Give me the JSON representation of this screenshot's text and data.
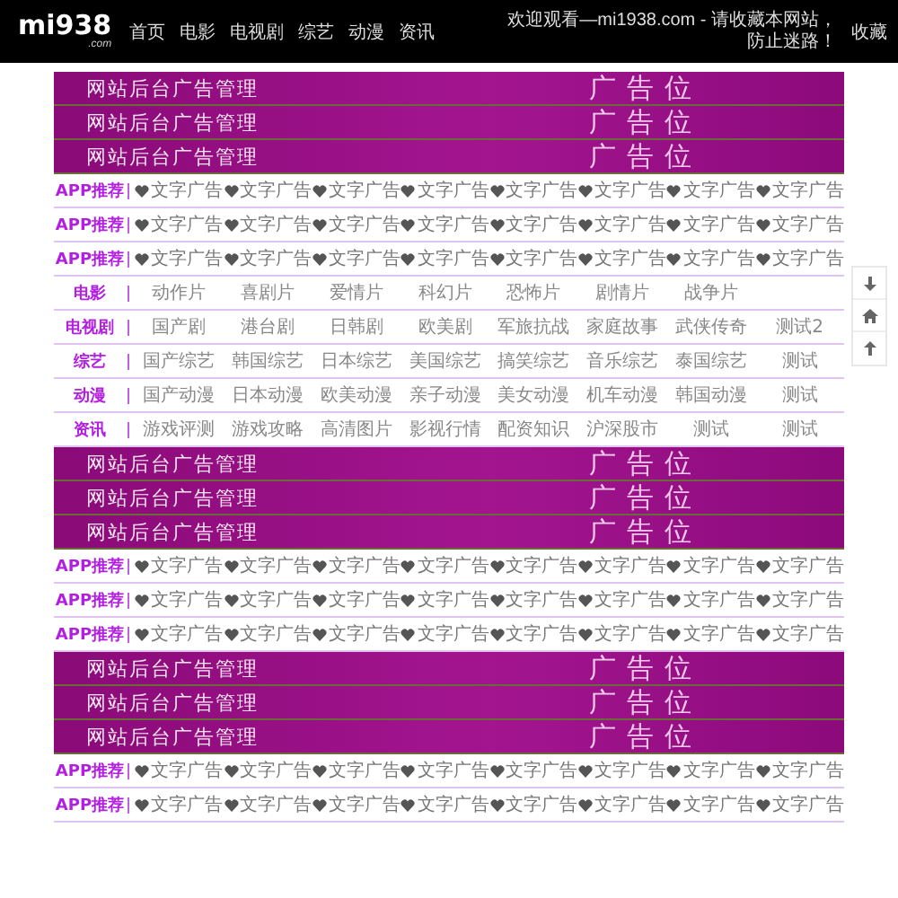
{
  "header": {
    "logo": "mi938",
    "logo_sub": ".com",
    "nav": [
      "首页",
      "电影",
      "电视剧",
      "综艺",
      "动漫",
      "资讯"
    ],
    "welcome": "欢迎观看—mi1938.com - 请收藏本网站，防止迷路！",
    "bookmark": "收藏"
  },
  "side_tools": [
    {
      "kind": "down"
    },
    {
      "kind": "home"
    },
    {
      "kind": "up"
    }
  ],
  "blocks": [
    {
      "kind": "banner",
      "title": "网站后台广告管理",
      "slot": "广告位"
    },
    {
      "kind": "banner",
      "title": "网站后台广告管理",
      "slot": "广告位"
    },
    {
      "kind": "banner",
      "title": "网站后台广告管理",
      "slot": "广告位"
    },
    {
      "kind": "app",
      "label": "APP推荐",
      "items": [
        "文字广告",
        "文字广告",
        "文字广告",
        "文字广告",
        "文字广告",
        "文字广告",
        "文字广告",
        "文字广告"
      ]
    },
    {
      "kind": "app",
      "label": "APP推荐",
      "items": [
        "文字广告",
        "文字广告",
        "文字广告",
        "文字广告",
        "文字广告",
        "文字广告",
        "文字广告",
        "文字广告"
      ]
    },
    {
      "kind": "app",
      "label": "APP推荐",
      "items": [
        "文字广告",
        "文字广告",
        "文字广告",
        "文字广告",
        "文字广告",
        "文字广告",
        "文字广告",
        "文字广告"
      ]
    },
    {
      "kind": "category",
      "label": "电影",
      "items": [
        "动作片",
        "喜剧片",
        "爱情片",
        "科幻片",
        "恐怖片",
        "剧情片",
        "战争片"
      ]
    },
    {
      "kind": "category",
      "label": "电视剧",
      "items": [
        "国产剧",
        "港台剧",
        "日韩剧",
        "欧美剧",
        "军旅抗战",
        "家庭故事",
        "武侠传奇",
        "测试2"
      ]
    },
    {
      "kind": "category",
      "label": "综艺",
      "items": [
        "国产综艺",
        "韩国综艺",
        "日本综艺",
        "美国综艺",
        "搞笑综艺",
        "音乐综艺",
        "泰国综艺",
        "测试"
      ]
    },
    {
      "kind": "category",
      "label": "动漫",
      "items": [
        "国产动漫",
        "日本动漫",
        "欧美动漫",
        "亲子动漫",
        "美女动漫",
        "机车动漫",
        "韩国动漫",
        "测试"
      ]
    },
    {
      "kind": "category",
      "label": "资讯",
      "items": [
        "游戏评测",
        "游戏攻略",
        "高清图片",
        "影视行情",
        "配资知识",
        "沪深股市",
        "测试",
        "测试"
      ]
    },
    {
      "kind": "banner",
      "title": "网站后台广告管理",
      "slot": "广告位"
    },
    {
      "kind": "banner",
      "title": "网站后台广告管理",
      "slot": "广告位"
    },
    {
      "kind": "banner",
      "title": "网站后台广告管理",
      "slot": "广告位"
    },
    {
      "kind": "app",
      "label": "APP推荐",
      "items": [
        "文字广告",
        "文字广告",
        "文字广告",
        "文字广告",
        "文字广告",
        "文字广告",
        "文字广告",
        "文字广告"
      ]
    },
    {
      "kind": "app",
      "label": "APP推荐",
      "items": [
        "文字广告",
        "文字广告",
        "文字广告",
        "文字广告",
        "文字广告",
        "文字广告",
        "文字广告",
        "文字广告"
      ]
    },
    {
      "kind": "app",
      "label": "APP推荐",
      "items": [
        "文字广告",
        "文字广告",
        "文字广告",
        "文字广告",
        "文字广告",
        "文字广告",
        "文字广告",
        "文字广告"
      ]
    },
    {
      "kind": "banner",
      "title": "网站后台广告管理",
      "slot": "广告位"
    },
    {
      "kind": "banner",
      "title": "网站后台广告管理",
      "slot": "广告位"
    },
    {
      "kind": "banner",
      "title": "网站后台广告管理",
      "slot": "广告位"
    },
    {
      "kind": "app",
      "label": "APP推荐",
      "items": [
        "文字广告",
        "文字广告",
        "文字广告",
        "文字广告",
        "文字广告",
        "文字广告",
        "文字广告",
        "文字广告"
      ]
    },
    {
      "kind": "app",
      "label": "APP推荐",
      "items": [
        "文字广告",
        "文字广告",
        "文字广告",
        "文字广告",
        "文字广告",
        "文字广告",
        "文字广告",
        "文字广告"
      ]
    }
  ]
}
